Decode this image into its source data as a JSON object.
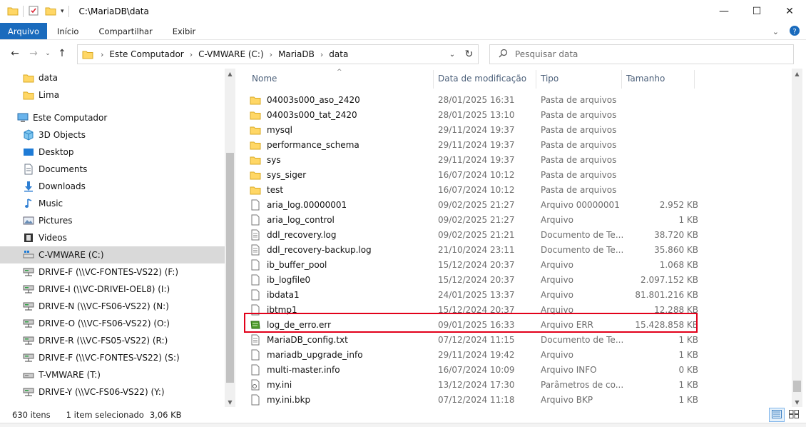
{
  "window": {
    "title": "C:\\MariaDB\\data",
    "minimize_glyph": "—",
    "maximize_glyph": "☐",
    "close_glyph": "✕"
  },
  "ribbon": {
    "tabs": [
      "Arquivo",
      "Início",
      "Compartilhar",
      "Exibir"
    ]
  },
  "address": {
    "crumbs": [
      "Este Computador",
      "C-VMWARE (C:)",
      "MariaDB",
      "data"
    ]
  },
  "search": {
    "placeholder": "Pesquisar data"
  },
  "nav": {
    "items": [
      {
        "label": "data",
        "icon": "folder-icon"
      },
      {
        "label": "Lima",
        "icon": "folder-icon"
      },
      {
        "label": "Este Computador",
        "icon": "computer-icon"
      },
      {
        "label": "3D Objects",
        "icon": "cube-icon"
      },
      {
        "label": "Desktop",
        "icon": "desktop-icon"
      },
      {
        "label": "Documents",
        "icon": "document-icon"
      },
      {
        "label": "Downloads",
        "icon": "download-icon"
      },
      {
        "label": "Music",
        "icon": "music-icon"
      },
      {
        "label": "Pictures",
        "icon": "pictures-icon"
      },
      {
        "label": "Videos",
        "icon": "video-icon"
      },
      {
        "label": "C-VMWARE (C:)",
        "icon": "local-drive-icon",
        "selected": true
      },
      {
        "label": "DRIVE-F (\\\\VC-FONTES-VS22) (F:)",
        "icon": "network-drive-icon"
      },
      {
        "label": "DRIVE-I (\\\\VC-DRIVEI-OEL8) (I:)",
        "icon": "network-drive-icon"
      },
      {
        "label": "DRIVE-N (\\\\VC-FS06-VS22) (N:)",
        "icon": "network-drive-icon"
      },
      {
        "label": "DRIVE-O (\\\\VC-FS06-VS22) (O:)",
        "icon": "network-drive-icon"
      },
      {
        "label": "DRIVE-R (\\\\VC-FS05-VS22) (R:)",
        "icon": "network-drive-icon"
      },
      {
        "label": "DRIVE-F (\\\\VC-FONTES-VS22) (S:)",
        "icon": "network-drive-icon"
      },
      {
        "label": "T-VMWARE (T:)",
        "icon": "drive-icon"
      },
      {
        "label": "DRIVE-Y (\\\\VC-FS06-VS22) (Y:)",
        "icon": "network-drive-icon"
      }
    ]
  },
  "columns": {
    "name": "Nome",
    "date": "Data de modificação",
    "type": "Tipo",
    "size": "Tamanho"
  },
  "files": [
    {
      "name": "04003s000_aso_2420",
      "date": "28/01/2025 16:31",
      "type": "Pasta de arquivos",
      "size": "",
      "icon": "folder-icon"
    },
    {
      "name": "04003s000_tat_2420",
      "date": "28/01/2025 13:10",
      "type": "Pasta de arquivos",
      "size": "",
      "icon": "folder-icon"
    },
    {
      "name": "mysql",
      "date": "29/11/2024 19:37",
      "type": "Pasta de arquivos",
      "size": "",
      "icon": "folder-icon"
    },
    {
      "name": "performance_schema",
      "date": "29/11/2024 19:37",
      "type": "Pasta de arquivos",
      "size": "",
      "icon": "folder-icon"
    },
    {
      "name": "sys",
      "date": "29/11/2024 19:37",
      "type": "Pasta de arquivos",
      "size": "",
      "icon": "folder-icon"
    },
    {
      "name": "sys_siger",
      "date": "16/07/2024 10:12",
      "type": "Pasta de arquivos",
      "size": "",
      "icon": "folder-icon"
    },
    {
      "name": "test",
      "date": "16/07/2024 10:12",
      "type": "Pasta de arquivos",
      "size": "",
      "icon": "folder-icon"
    },
    {
      "name": "aria_log.00000001",
      "date": "09/02/2025 21:27",
      "type": "Arquivo 00000001",
      "size": "2.952 KB",
      "icon": "file-icon"
    },
    {
      "name": "aria_log_control",
      "date": "09/02/2025 21:27",
      "type": "Arquivo",
      "size": "1 KB",
      "icon": "file-icon"
    },
    {
      "name": "ddl_recovery.log",
      "date": "09/02/2025 21:21",
      "type": "Documento de Te...",
      "size": "38.720 KB",
      "icon": "text-file-icon"
    },
    {
      "name": "ddl_recovery-backup.log",
      "date": "21/10/2024 23:11",
      "type": "Documento de Te...",
      "size": "35.860 KB",
      "icon": "text-file-icon"
    },
    {
      "name": "ib_buffer_pool",
      "date": "15/12/2024 20:37",
      "type": "Arquivo",
      "size": "1.068 KB",
      "icon": "file-icon"
    },
    {
      "name": "ib_logfile0",
      "date": "15/12/2024 20:37",
      "type": "Arquivo",
      "size": "2.097.152 KB",
      "icon": "file-icon"
    },
    {
      "name": "ibdata1",
      "date": "24/01/2025 13:37",
      "type": "Arquivo",
      "size": "81.801.216 KB",
      "icon": "file-icon"
    },
    {
      "name": "ibtmp1",
      "date": "15/12/2024 20:37",
      "type": "Arquivo",
      "size": "12.288 KB",
      "icon": "file-icon"
    },
    {
      "name": "log_de_erro.err",
      "date": "09/01/2025 16:33",
      "type": "Arquivo ERR",
      "size": "15.428.858 KB",
      "icon": "err-file-icon",
      "highlighted": true
    },
    {
      "name": "MariaDB_config.txt",
      "date": "07/12/2024 11:15",
      "type": "Documento de Te...",
      "size": "1 KB",
      "icon": "text-file-icon"
    },
    {
      "name": "mariadb_upgrade_info",
      "date": "29/11/2024 19:42",
      "type": "Arquivo",
      "size": "1 KB",
      "icon": "file-icon"
    },
    {
      "name": "multi-master.info",
      "date": "16/07/2024 10:09",
      "type": "Arquivo INFO",
      "size": "0 KB",
      "icon": "file-icon"
    },
    {
      "name": "my.ini",
      "date": "13/12/2024 17:30",
      "type": "Parâmetros de co...",
      "size": "1 KB",
      "icon": "config-file-icon"
    },
    {
      "name": "my.ini.bkp",
      "date": "07/12/2024 11:18",
      "type": "Arquivo BKP",
      "size": "1 KB",
      "icon": "file-icon"
    }
  ],
  "status": {
    "count": "630 itens",
    "selected": "1 item selecionado",
    "size": "3,06 KB"
  },
  "colors": {
    "file_tab": "#1a6bbd",
    "highlight_border": "#e2001a",
    "folder_yellow": "#ffd766",
    "selected_nav": "#d9d9d9"
  }
}
